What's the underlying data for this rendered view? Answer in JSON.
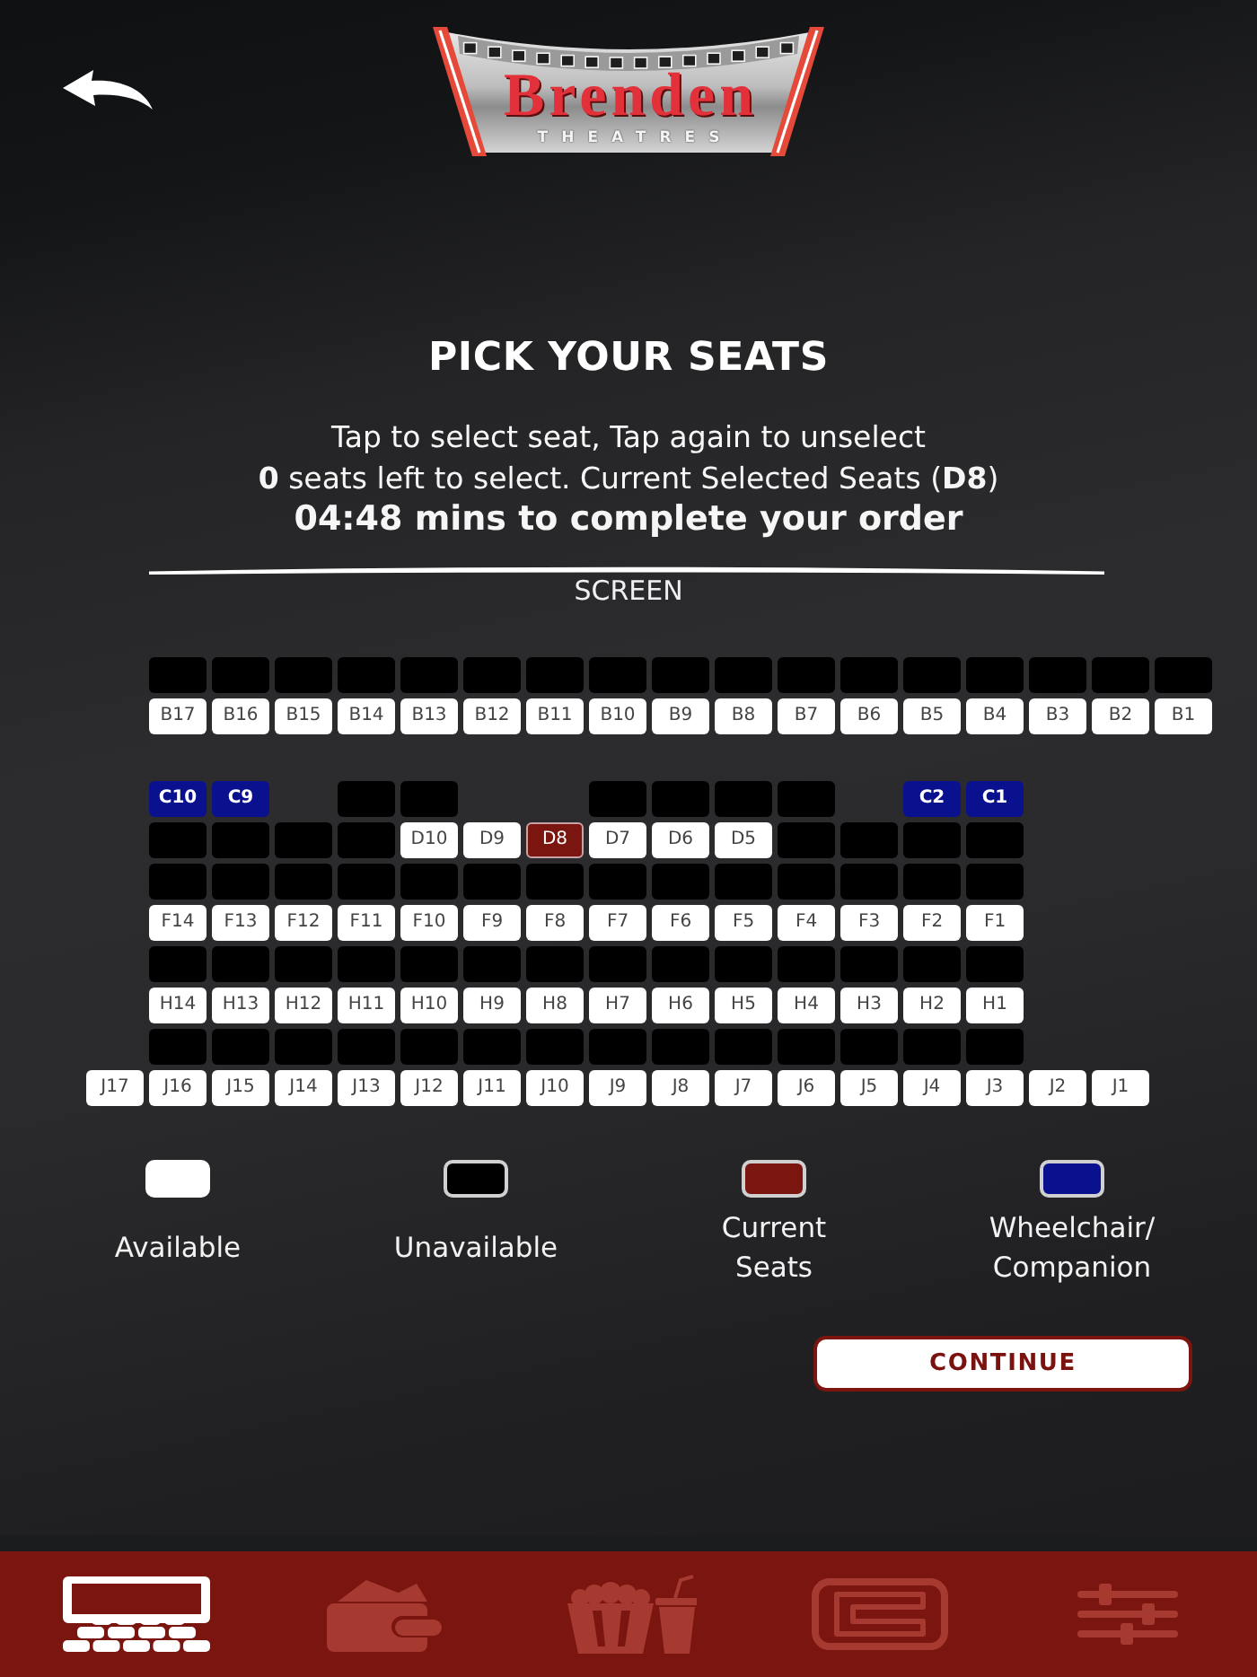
{
  "header": {
    "logo": {
      "name": "Brenden",
      "tagline": "THEATRES"
    }
  },
  "title": "PICK YOUR SEATS",
  "instructions": [
    "Tap to select seat, Tap again to unselect",
    "**0** seats left to select. Current Selected Seats (**D8**)"
  ],
  "timer": "04:48 mins to complete your order",
  "screen_label": "SCREEN",
  "seat_map": {
    "rows": [
      {
        "kind": "seats",
        "seats": [
          {
            "kind": "space"
          },
          {
            "kind": "seat",
            "available": false,
            "selected": false
          },
          {
            "kind": "seat",
            "available": false,
            "selected": false
          },
          {
            "kind": "seat",
            "available": false,
            "selected": false
          },
          {
            "kind": "seat",
            "available": false,
            "selected": false
          },
          {
            "kind": "seat",
            "available": false,
            "selected": false
          },
          {
            "kind": "seat",
            "available": false,
            "selected": false
          },
          {
            "kind": "seat",
            "available": false,
            "selected": false
          },
          {
            "kind": "seat",
            "available": false,
            "selected": false
          },
          {
            "kind": "seat",
            "available": false,
            "selected": false
          },
          {
            "kind": "seat",
            "available": false,
            "selected": false
          },
          {
            "kind": "seat",
            "available": false,
            "selected": false
          },
          {
            "kind": "seat",
            "available": false,
            "selected": false
          },
          {
            "kind": "seat",
            "available": false,
            "selected": false
          },
          {
            "kind": "seat",
            "available": false,
            "selected": false
          },
          {
            "kind": "seat",
            "available": false,
            "selected": false
          },
          {
            "kind": "seat",
            "available": false,
            "selected": false
          },
          {
            "kind": "seat",
            "available": false,
            "selected": false
          }
        ]
      },
      {
        "kind": "seats",
        "seats": [
          {
            "kind": "space"
          },
          {
            "kind": "seat",
            "label": "B17",
            "available": true,
            "selected": false
          },
          {
            "kind": "seat",
            "label": "B16",
            "available": true,
            "selected": false
          },
          {
            "kind": "seat",
            "label": "B15",
            "available": true,
            "selected": false
          },
          {
            "kind": "seat",
            "label": "B14",
            "available": true,
            "selected": false
          },
          {
            "kind": "seat",
            "label": "B13",
            "available": true,
            "selected": false
          },
          {
            "kind": "seat",
            "label": "B12",
            "available": true,
            "selected": false
          },
          {
            "kind": "seat",
            "label": "B11",
            "available": true,
            "selected": false
          },
          {
            "kind": "seat",
            "label": "B10",
            "available": true,
            "selected": false
          },
          {
            "kind": "seat",
            "label": "B9",
            "available": true,
            "selected": false
          },
          {
            "kind": "seat",
            "label": "B8",
            "available": true,
            "selected": false
          },
          {
            "kind": "seat",
            "label": "B7",
            "available": true,
            "selected": false
          },
          {
            "kind": "seat",
            "label": "B6",
            "available": true,
            "selected": false
          },
          {
            "kind": "seat",
            "label": "B5",
            "available": true,
            "selected": false
          },
          {
            "kind": "seat",
            "label": "B4",
            "available": true,
            "selected": false
          },
          {
            "kind": "seat",
            "label": "B3",
            "available": true,
            "selected": false
          },
          {
            "kind": "seat",
            "label": "B2",
            "available": true,
            "selected": false
          },
          {
            "kind": "seat",
            "label": "B1",
            "available": true,
            "selected": false
          }
        ]
      },
      {
        "kind": "aisle"
      },
      {
        "kind": "seats",
        "seats": [
          {
            "kind": "space"
          },
          {
            "kind": "wheelchair",
            "label": "C10",
            "available": true,
            "selected": false
          },
          {
            "kind": "wheelchair",
            "label": "C9",
            "available": true,
            "selected": false
          },
          {
            "kind": "space"
          },
          {
            "kind": "seat",
            "available": false,
            "selected": false
          },
          {
            "kind": "seat",
            "available": false,
            "selected": false
          },
          {
            "kind": "space"
          },
          {
            "kind": "space"
          },
          {
            "kind": "seat",
            "available": false,
            "selected": false
          },
          {
            "kind": "seat",
            "available": false,
            "selected": false
          },
          {
            "kind": "seat",
            "available": false,
            "selected": false
          },
          {
            "kind": "seat",
            "available": false,
            "selected": false
          },
          {
            "kind": "space"
          },
          {
            "kind": "wheelchair",
            "label": "C2",
            "available": true,
            "selected": false
          },
          {
            "kind": "wheelchair",
            "label": "C1",
            "available": true,
            "selected": false
          }
        ]
      },
      {
        "kind": "seats",
        "seats": [
          {
            "kind": "space"
          },
          {
            "kind": "seat",
            "available": false,
            "selected": false
          },
          {
            "kind": "seat",
            "available": false,
            "selected": false
          },
          {
            "kind": "seat",
            "available": false,
            "selected": false
          },
          {
            "kind": "seat",
            "available": false,
            "selected": false
          },
          {
            "kind": "seat",
            "label": "D10",
            "available": true,
            "selected": false
          },
          {
            "kind": "seat",
            "label": "D9",
            "available": true,
            "selected": false
          },
          {
            "kind": "seat",
            "label": "D8",
            "available": true,
            "selected": true
          },
          {
            "kind": "seat",
            "label": "D7",
            "available": true,
            "selected": false
          },
          {
            "kind": "seat",
            "label": "D6",
            "available": true,
            "selected": false
          },
          {
            "kind": "seat",
            "label": "D5",
            "available": true,
            "selected": false
          },
          {
            "kind": "seat",
            "available": false,
            "selected": false
          },
          {
            "kind": "seat",
            "available": false,
            "selected": false
          },
          {
            "kind": "seat",
            "available": false,
            "selected": false
          },
          {
            "kind": "seat",
            "available": false,
            "selected": false
          }
        ]
      },
      {
        "kind": "seats",
        "seats": [
          {
            "kind": "space"
          },
          {
            "kind": "seat",
            "available": false,
            "selected": false
          },
          {
            "kind": "seat",
            "available": false,
            "selected": false
          },
          {
            "kind": "seat",
            "available": false,
            "selected": false
          },
          {
            "kind": "seat",
            "available": false,
            "selected": false
          },
          {
            "kind": "seat",
            "available": false,
            "selected": false
          },
          {
            "kind": "seat",
            "available": false,
            "selected": false
          },
          {
            "kind": "seat",
            "available": false,
            "selected": false
          },
          {
            "kind": "seat",
            "available": false,
            "selected": false
          },
          {
            "kind": "seat",
            "available": false,
            "selected": false
          },
          {
            "kind": "seat",
            "available": false,
            "selected": false
          },
          {
            "kind": "seat",
            "available": false,
            "selected": false
          },
          {
            "kind": "seat",
            "available": false,
            "selected": false
          },
          {
            "kind": "seat",
            "available": false,
            "selected": false
          },
          {
            "kind": "seat",
            "available": false,
            "selected": false
          }
        ]
      },
      {
        "kind": "seats",
        "seats": [
          {
            "kind": "space"
          },
          {
            "kind": "seat",
            "label": "F14",
            "available": true,
            "selected": false
          },
          {
            "kind": "seat",
            "label": "F13",
            "available": true,
            "selected": false
          },
          {
            "kind": "seat",
            "label": "F12",
            "available": true,
            "selected": false
          },
          {
            "kind": "seat",
            "label": "F11",
            "available": true,
            "selected": false
          },
          {
            "kind": "seat",
            "label": "F10",
            "available": true,
            "selected": false
          },
          {
            "kind": "seat",
            "label": "F9",
            "available": true,
            "selected": false
          },
          {
            "kind": "seat",
            "label": "F8",
            "available": true,
            "selected": false
          },
          {
            "kind": "seat",
            "label": "F7",
            "available": true,
            "selected": false
          },
          {
            "kind": "seat",
            "label": "F6",
            "available": true,
            "selected": false
          },
          {
            "kind": "seat",
            "label": "F5",
            "available": true,
            "selected": false
          },
          {
            "kind": "seat",
            "label": "F4",
            "available": true,
            "selected": false
          },
          {
            "kind": "seat",
            "label": "F3",
            "available": true,
            "selected": false
          },
          {
            "kind": "seat",
            "label": "F2",
            "available": true,
            "selected": false
          },
          {
            "kind": "seat",
            "label": "F1",
            "available": true,
            "selected": false
          }
        ]
      },
      {
        "kind": "seats",
        "seats": [
          {
            "kind": "space"
          },
          {
            "kind": "seat",
            "available": false,
            "selected": false
          },
          {
            "kind": "seat",
            "available": false,
            "selected": false
          },
          {
            "kind": "seat",
            "available": false,
            "selected": false
          },
          {
            "kind": "seat",
            "available": false,
            "selected": false
          },
          {
            "kind": "seat",
            "available": false,
            "selected": false
          },
          {
            "kind": "seat",
            "available": false,
            "selected": false
          },
          {
            "kind": "seat",
            "available": false,
            "selected": false
          },
          {
            "kind": "seat",
            "available": false,
            "selected": false
          },
          {
            "kind": "seat",
            "available": false,
            "selected": false
          },
          {
            "kind": "seat",
            "available": false,
            "selected": false
          },
          {
            "kind": "seat",
            "available": false,
            "selected": false
          },
          {
            "kind": "seat",
            "available": false,
            "selected": false
          },
          {
            "kind": "seat",
            "available": false,
            "selected": false
          },
          {
            "kind": "seat",
            "available": false,
            "selected": false
          }
        ]
      },
      {
        "kind": "seats",
        "seats": [
          {
            "kind": "space"
          },
          {
            "kind": "seat",
            "label": "H14",
            "available": true,
            "selected": false
          },
          {
            "kind": "seat",
            "label": "H13",
            "available": true,
            "selected": false
          },
          {
            "kind": "seat",
            "label": "H12",
            "available": true,
            "selected": false
          },
          {
            "kind": "seat",
            "label": "H11",
            "available": true,
            "selected": false
          },
          {
            "kind": "seat",
            "label": "H10",
            "available": true,
            "selected": false
          },
          {
            "kind": "seat",
            "label": "H9",
            "available": true,
            "selected": false
          },
          {
            "kind": "seat",
            "label": "H8",
            "available": true,
            "selected": false
          },
          {
            "kind": "seat",
            "label": "H7",
            "available": true,
            "selected": false
          },
          {
            "kind": "seat",
            "label": "H6",
            "available": true,
            "selected": false
          },
          {
            "kind": "seat",
            "label": "H5",
            "available": true,
            "selected": false
          },
          {
            "kind": "seat",
            "label": "H4",
            "available": true,
            "selected": false
          },
          {
            "kind": "seat",
            "label": "H3",
            "available": true,
            "selected": false
          },
          {
            "kind": "seat",
            "label": "H2",
            "available": true,
            "selected": false
          },
          {
            "kind": "seat",
            "label": "H1",
            "available": true,
            "selected": false
          }
        ]
      },
      {
        "kind": "seats",
        "seats": [
          {
            "kind": "space"
          },
          {
            "kind": "seat",
            "available": false,
            "selected": false
          },
          {
            "kind": "seat",
            "available": false,
            "selected": false
          },
          {
            "kind": "seat",
            "available": false,
            "selected": false
          },
          {
            "kind": "seat",
            "available": false,
            "selected": false
          },
          {
            "kind": "seat",
            "available": false,
            "selected": false
          },
          {
            "kind": "seat",
            "available": false,
            "selected": false
          },
          {
            "kind": "seat",
            "available": false,
            "selected": false
          },
          {
            "kind": "seat",
            "available": false,
            "selected": false
          },
          {
            "kind": "seat",
            "available": false,
            "selected": false
          },
          {
            "kind": "seat",
            "available": false,
            "selected": false
          },
          {
            "kind": "seat",
            "available": false,
            "selected": false
          },
          {
            "kind": "seat",
            "available": false,
            "selected": false
          },
          {
            "kind": "seat",
            "available": false,
            "selected": false
          },
          {
            "kind": "seat",
            "available": false,
            "selected": false
          }
        ]
      },
      {
        "kind": "seats",
        "seats": [
          {
            "kind": "seat",
            "label": "J17",
            "available": true,
            "selected": false
          },
          {
            "kind": "seat",
            "label": "J16",
            "available": true,
            "selected": false
          },
          {
            "kind": "seat",
            "label": "J15",
            "available": true,
            "selected": false
          },
          {
            "kind": "seat",
            "label": "J14",
            "available": true,
            "selected": false
          },
          {
            "kind": "seat",
            "label": "J13",
            "available": true,
            "selected": false
          },
          {
            "kind": "seat",
            "label": "J12",
            "available": true,
            "selected": false
          },
          {
            "kind": "seat",
            "label": "J11",
            "available": true,
            "selected": false
          },
          {
            "kind": "seat",
            "label": "J10",
            "available": true,
            "selected": false
          },
          {
            "kind": "seat",
            "label": "J9",
            "available": true,
            "selected": false
          },
          {
            "kind": "seat",
            "label": "J8",
            "available": true,
            "selected": false
          },
          {
            "kind": "seat",
            "label": "J7",
            "available": true,
            "selected": false
          },
          {
            "kind": "seat",
            "label": "J6",
            "available": true,
            "selected": false
          },
          {
            "kind": "seat",
            "label": "J5",
            "available": true,
            "selected": false
          },
          {
            "kind": "seat",
            "label": "J4",
            "available": true,
            "selected": false
          },
          {
            "kind": "seat",
            "label": "J3",
            "available": true,
            "selected": false
          },
          {
            "kind": "seat",
            "label": "J2",
            "available": true,
            "selected": false
          },
          {
            "kind": "seat",
            "label": "J1",
            "available": true,
            "selected": false
          }
        ]
      }
    ]
  },
  "legend": [
    {
      "kind": "available",
      "label": "Available"
    },
    {
      "kind": "unavailable",
      "label": "Unavailable"
    },
    {
      "kind": "selected",
      "label": "Current\nSeats"
    },
    {
      "kind": "wheelchair",
      "label": "Wheelchair/\nCompanion"
    }
  ],
  "continue_button": {
    "label": "CONTINUE"
  },
  "nav_tabs": [
    {
      "kind": "seats",
      "selected": true
    },
    {
      "kind": "wallet",
      "selected": false
    },
    {
      "kind": "concessions",
      "selected": false
    },
    {
      "kind": "club",
      "selected": false
    },
    {
      "kind": "settings",
      "selected": false
    }
  ]
}
